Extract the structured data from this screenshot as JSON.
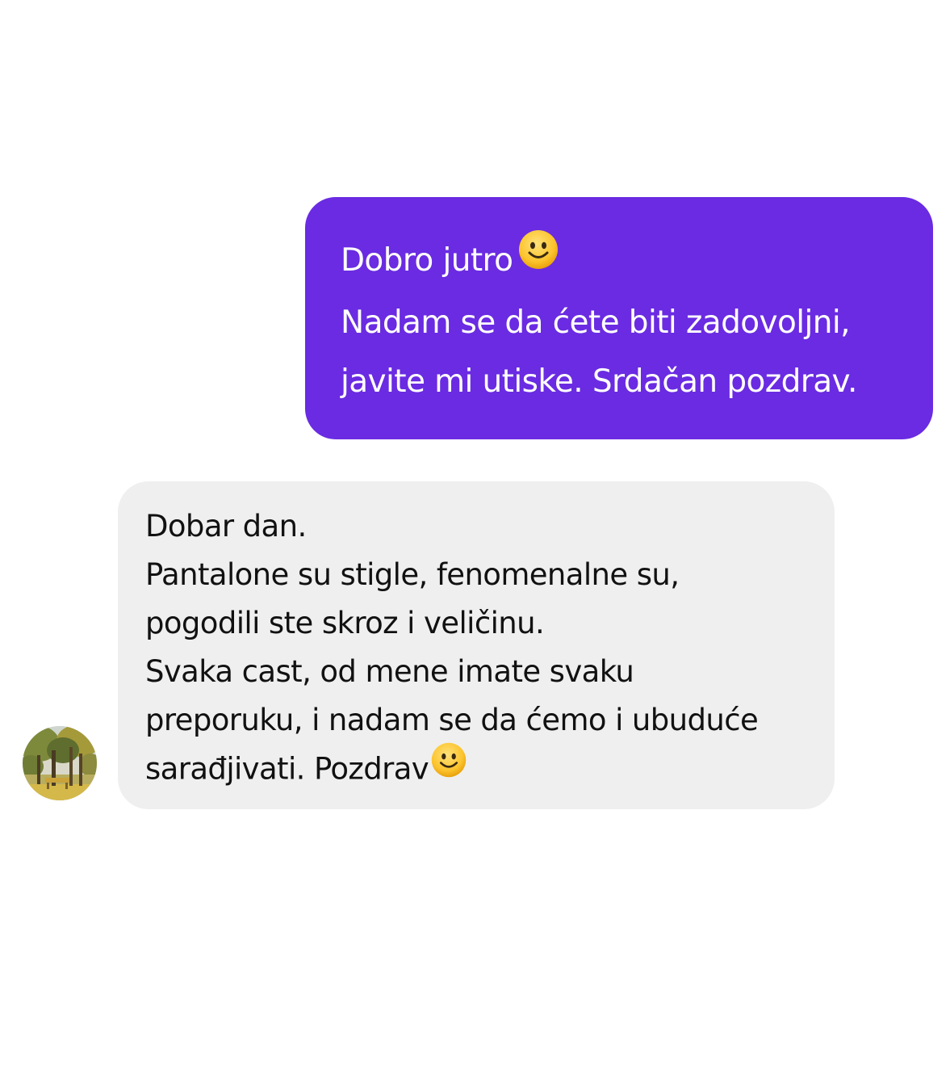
{
  "conversation": {
    "sent_message": {
      "lines": [
        "Dobro jutro",
        "Nadam se da ćete biti zadovoljni,",
        "javite mi utiske. Srdačan pozdrav."
      ],
      "emoji": "slightly-smiling-face-icon"
    },
    "received_message": {
      "lines": [
        "Dobar dan.",
        "Pantalone su stigle, fenomenalne su,",
        "pogodili ste skroz i veličinu.",
        "Svaka cast, od mene imate svaku",
        "preporuku, i nadam se da ćemo i ubuduće",
        "sarađjivati. Pozdrav"
      ],
      "emoji": "slightly-smiling-face-icon"
    },
    "colors": {
      "sent_bubble": "#6a2be2",
      "received_bubble": "#efefef",
      "background": "#ffffff"
    }
  }
}
